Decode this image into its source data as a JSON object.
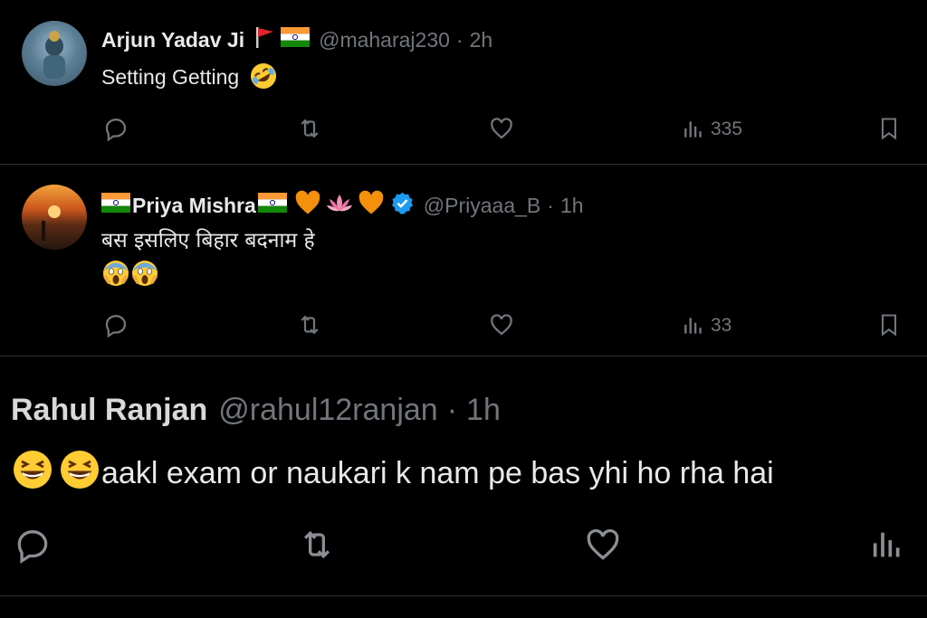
{
  "tweets": [
    {
      "name": "Arjun Yadav Ji",
      "handle": "@maharaj230",
      "separator": "·",
      "time": "2h",
      "text": "Setting Getting",
      "text_emoji": "rolling-on-floor-laughing",
      "views": "335"
    },
    {
      "name": "Priya Mishra",
      "handle": "@Priyaaa_B",
      "separator": "·",
      "time": "1h",
      "text": "बस इसलिए बिहार बदनाम हे",
      "verified": true,
      "views": "33"
    },
    {
      "name": "Rahul Ranjan",
      "handle": "@rahul12ranjan",
      "separator": "·",
      "time": "1h",
      "text": "aakl exam or naukari k nam pe bas yhi ho rha hai"
    }
  ],
  "colors": {
    "background": "#000000",
    "text": "#e7e9ea",
    "muted": "#71767b",
    "divider": "#2f3336",
    "verified": "#1d9bf0",
    "heart_emoji": "#f4900c"
  },
  "icons": [
    "reply-icon",
    "retweet-icon",
    "like-icon",
    "views-icon",
    "bookmark-icon",
    "verified-badge-icon"
  ]
}
